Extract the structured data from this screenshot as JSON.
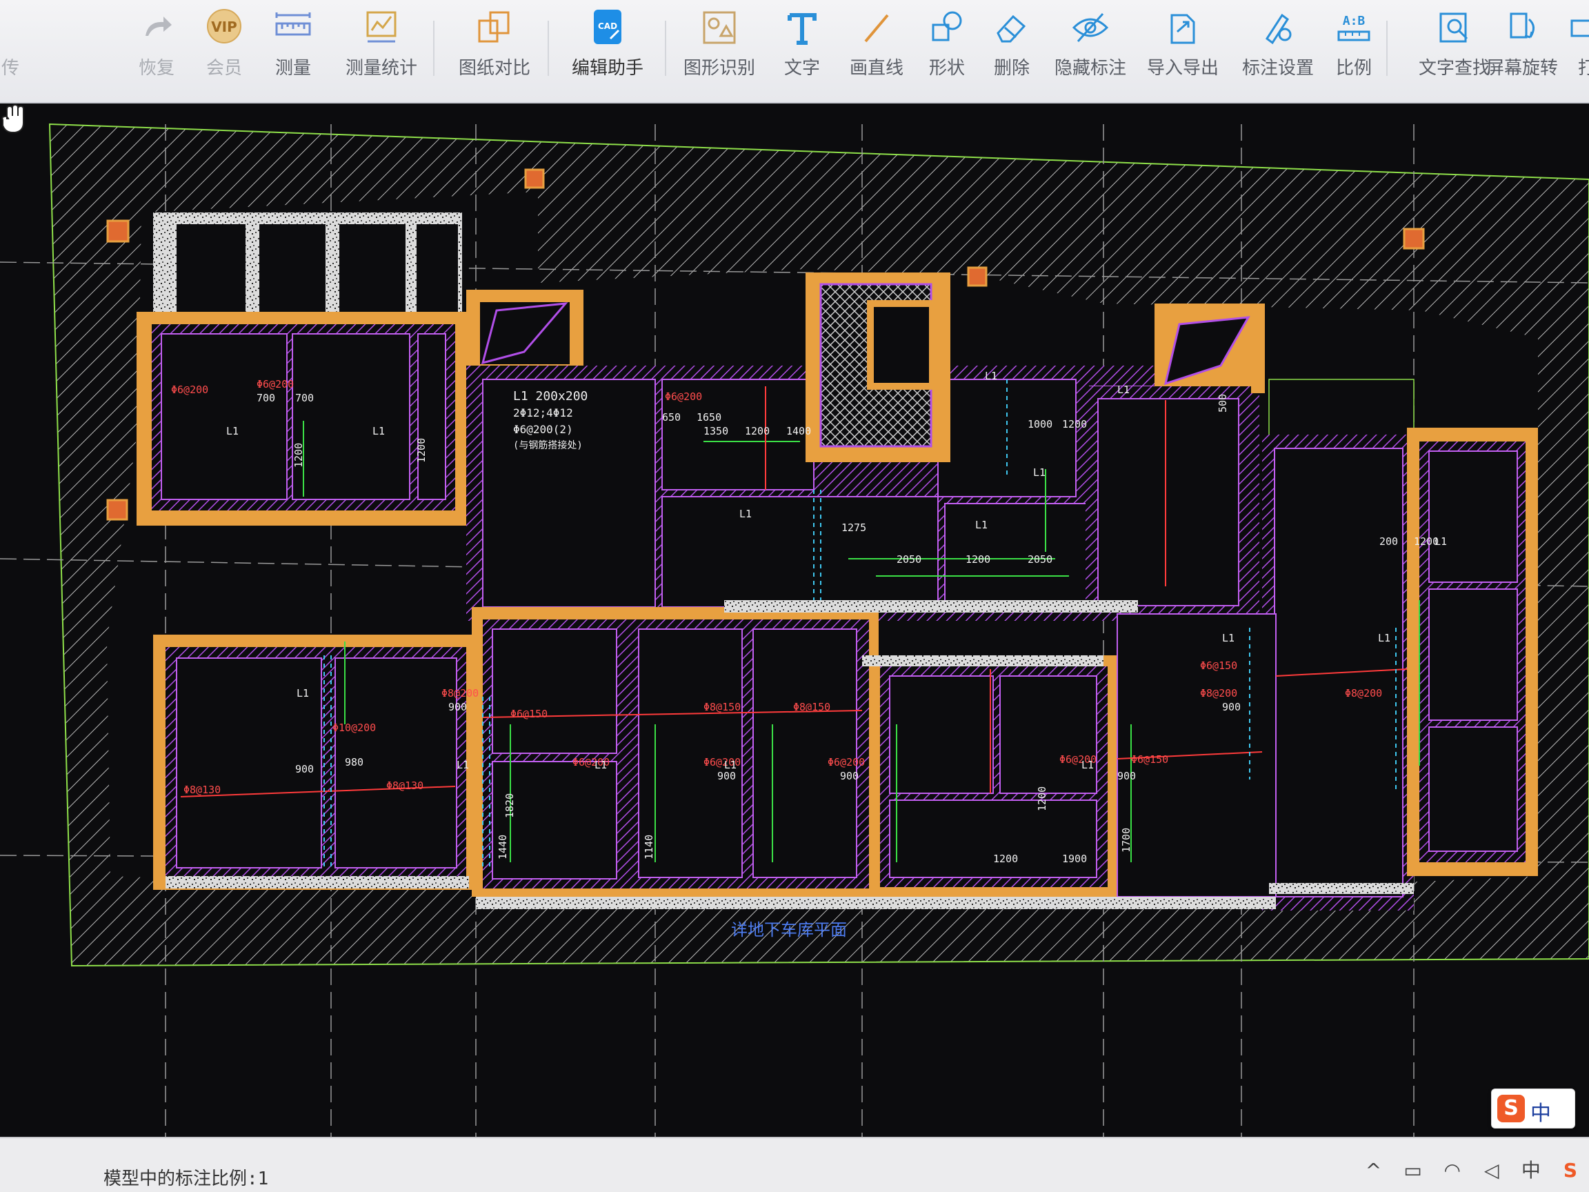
{
  "toolbar": {
    "items": [
      {
        "label": "传",
        "icon": "share-icon"
      },
      {
        "label": "恢复",
        "icon": "redo-icon"
      },
      {
        "label": "会员",
        "icon": "vip-icon"
      },
      {
        "label": "测量",
        "icon": "ruler-icon"
      },
      {
        "label": "测量统计",
        "icon": "measure-stats-icon"
      },
      {
        "label": "图纸对比",
        "icon": "compare-icon"
      },
      {
        "label": "编辑助手",
        "icon": "cad-edit-icon"
      },
      {
        "label": "图形识别",
        "icon": "shape-recognition-icon"
      },
      {
        "label": "文字",
        "icon": "text-icon"
      },
      {
        "label": "画直线",
        "icon": "line-icon"
      },
      {
        "label": "形状",
        "icon": "shape-icon"
      },
      {
        "label": "删除",
        "icon": "eraser-icon"
      },
      {
        "label": "隐藏标注",
        "icon": "hide-eye-icon"
      },
      {
        "label": "导入导出",
        "icon": "import-export-icon"
      },
      {
        "label": "标注设置",
        "icon": "annotation-settings-icon"
      },
      {
        "label": "比例",
        "icon": "scale-icon"
      },
      {
        "label": "文字查找",
        "icon": "text-search-icon"
      },
      {
        "label": "屏幕旋转",
        "icon": "screen-rotate-icon"
      },
      {
        "label": "打",
        "icon": "print-icon"
      }
    ],
    "cad_badge": "CAD",
    "scale_badge": "A:B",
    "vip_badge": "VIP"
  },
  "drawing": {
    "note_main": "L1 200x200",
    "note_line2": "2Φ12;4Φ12",
    "note_line3": "Φ6@200(2)",
    "note_line4": "(与钢筋搭接处)",
    "bottom_title": "详地下车库平面",
    "dims": [
      "700",
      "700",
      "1200",
      "1200",
      "650",
      "1650",
      "1350",
      "1200",
      "1400",
      "1000",
      "1200",
      "1275",
      "2050",
      "1200",
      "2050",
      "500",
      "200",
      "1200",
      "900",
      "900",
      "980",
      "1820",
      "1440",
      "1140",
      "900",
      "900",
      "1200",
      "900",
      "1200",
      "1900",
      "1700",
      "900"
    ],
    "rebars": [
      "Φ6@200",
      "Φ8@200",
      "Φ10@200",
      "Φ6@150",
      "Φ8@150",
      "Φ8@130"
    ],
    "beam_tag": "L1"
  },
  "status": {
    "text": "模型中的标注比例:1"
  },
  "tray": {
    "ime_logo": "S",
    "ime_lang": "中",
    "ime_extra": "°,"
  }
}
